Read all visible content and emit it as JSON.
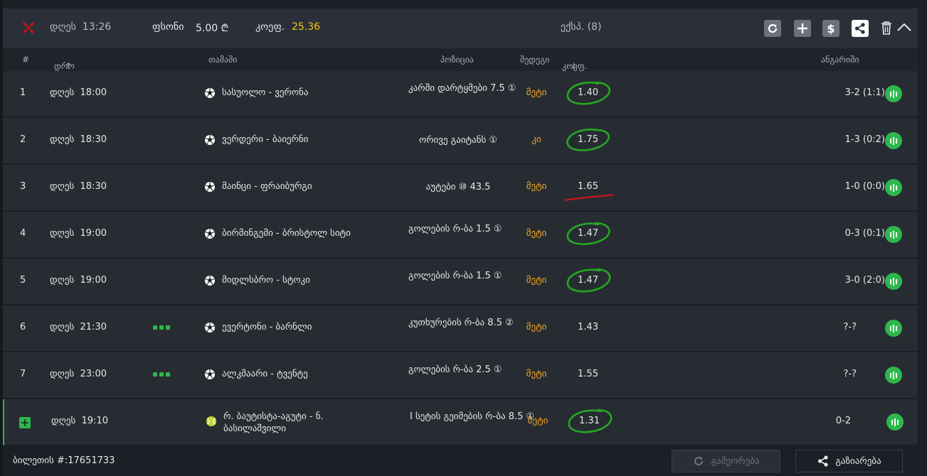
{
  "header": {
    "date_label": "დღეს",
    "time": "13:26",
    "stake_label": "ფსონი",
    "stake_value": "5.00 ₾",
    "coef_label": "კოეფ.",
    "coef_value": "25.36",
    "express_label": "ექსპ. (8)",
    "icons": [
      "close-x-icon",
      "refresh-icon",
      "plus-icon",
      "dollar-icon",
      "share-icon",
      "trash-icon",
      "chevron-up-icon"
    ]
  },
  "columns": {
    "num": "#",
    "time": "დრო",
    "game": "თამაში",
    "position": "პოზიცია",
    "outcome": "შედეგი",
    "coef": "კოეფ.",
    "settlement": "ანგარიში"
  },
  "colors": {
    "accent_green": "#2db84b",
    "pick_orange": "#f5a623",
    "coef_yellow": "#f5c518",
    "mark_green": "#25a821",
    "mark_red": "#d0121a"
  },
  "rows": [
    {
      "num": "1",
      "date": "დღეს",
      "time": "18:00",
      "live": false,
      "sport": "soccer-ball-icon",
      "match": "სასუოლო - ვერონა",
      "position": "კარში დარტყმები 7.5 ①",
      "pick": "მეტი",
      "coef": "1.40",
      "result": "3-2 (1:1)",
      "mark": "circle"
    },
    {
      "num": "2",
      "date": "დღეს",
      "time": "18:30",
      "live": false,
      "sport": "soccer-ball-icon",
      "match": "ვერდერი - ბაიერნი",
      "position": "ორივე გაიტანს ①",
      "pick": "კი",
      "coef": "1.75",
      "result": "1-3 (0:2)",
      "mark": "circle"
    },
    {
      "num": "3",
      "date": "დღეს",
      "time": "18:30",
      "live": false,
      "sport": "soccer-ball-icon",
      "match": "მაინცი - ფრაიბურგი",
      "position": "აუტები ⑩ 43.5",
      "pick": "მეტი",
      "coef": "1.65",
      "result": "1-0 (0:0)",
      "mark": "strike"
    },
    {
      "num": "4",
      "date": "დღეს",
      "time": "19:00",
      "live": false,
      "sport": "soccer-ball-icon",
      "match": "ბირმინგემი - ბრისტოლ სიტი",
      "position": "გოლების რ-ბა 1.5 ①",
      "pick": "მეტი",
      "coef": "1.47",
      "result": "0-3 (0:1)",
      "mark": "circle"
    },
    {
      "num": "5",
      "date": "დღეს",
      "time": "19:00",
      "live": false,
      "sport": "soccer-ball-icon",
      "match": "მიდლსბრო - სტოკი",
      "position": "გოლების რ-ბა 1.5 ①",
      "pick": "მეტი",
      "coef": "1.47",
      "result": "3-0 (2:0)",
      "mark": "circle"
    },
    {
      "num": "6",
      "date": "დღეს",
      "time": "21:30",
      "live": true,
      "sport": "soccer-ball-icon",
      "match": "ევერტონი - ბარნლი",
      "position": "კუთხურების რ-ბა 8.5 ②",
      "pick": "მეტი",
      "coef": "1.43",
      "result": "?-?",
      "mark": "none"
    },
    {
      "num": "7",
      "date": "დღეს",
      "time": "23:00",
      "live": true,
      "sport": "soccer-ball-icon",
      "match": "ალკმაარი - ტვენტე",
      "position": "გოლების რ-ბა 2.5 ①",
      "pick": "მეტი",
      "coef": "1.55",
      "result": "?-?",
      "mark": "none"
    },
    {
      "num": "",
      "date": "დღეს",
      "time": "19:10",
      "live": false,
      "sport": "tennis-ball-icon",
      "match": "რ. ბაუტისტა-აგუტი - ნ. ბასილაშვილი",
      "position": "I სეტის გეიმების რ-ბა 8.5 ①",
      "pick": "მეტი",
      "coef": "1.31",
      "result": "0-2",
      "mark": "circle"
    }
  ],
  "footer": {
    "ticket": "ბილეთის #:17651733",
    "repeat_label": "გამეორება",
    "share_label": "გაზიარება"
  }
}
